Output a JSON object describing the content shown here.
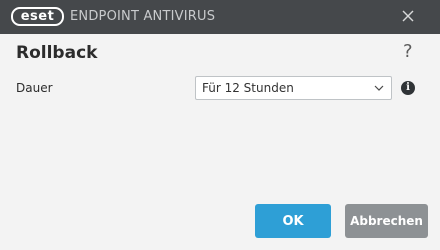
{
  "titlebar": {
    "logo_text": "eset",
    "product_name": "ENDPOINT ANTIVIRUS",
    "close_icon": "close-icon",
    "background": "#45484b"
  },
  "dialog": {
    "title": "Rollback",
    "help_label": "?"
  },
  "duration": {
    "label": "Dauer",
    "selected": "Für 12 Stunden",
    "dropdown_icon": "chevron-down-icon",
    "info_label": "i"
  },
  "buttons": {
    "ok": "OK",
    "cancel": "Abbrechen",
    "ok_color": "#2e9fd6",
    "cancel_color": "#8d9194"
  }
}
